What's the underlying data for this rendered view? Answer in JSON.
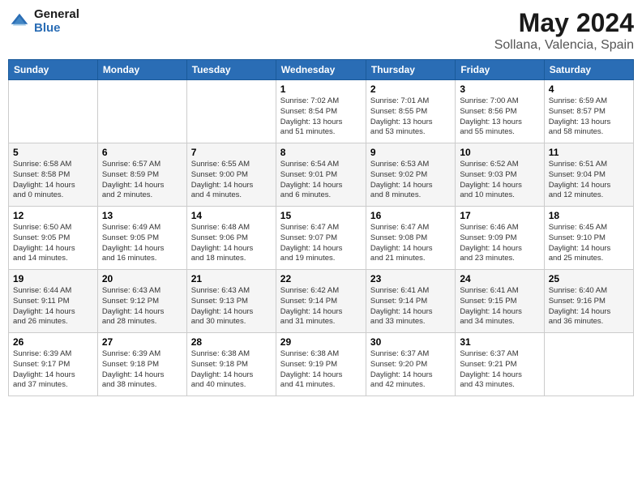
{
  "logo": {
    "line1": "General",
    "line2": "Blue"
  },
  "title": "May 2024",
  "subtitle": "Sollana, Valencia, Spain",
  "header_days": [
    "Sunday",
    "Monday",
    "Tuesday",
    "Wednesday",
    "Thursday",
    "Friday",
    "Saturday"
  ],
  "weeks": [
    [
      {
        "day": "",
        "info": ""
      },
      {
        "day": "",
        "info": ""
      },
      {
        "day": "",
        "info": ""
      },
      {
        "day": "1",
        "info": "Sunrise: 7:02 AM\nSunset: 8:54 PM\nDaylight: 13 hours\nand 51 minutes."
      },
      {
        "day": "2",
        "info": "Sunrise: 7:01 AM\nSunset: 8:55 PM\nDaylight: 13 hours\nand 53 minutes."
      },
      {
        "day": "3",
        "info": "Sunrise: 7:00 AM\nSunset: 8:56 PM\nDaylight: 13 hours\nand 55 minutes."
      },
      {
        "day": "4",
        "info": "Sunrise: 6:59 AM\nSunset: 8:57 PM\nDaylight: 13 hours\nand 58 minutes."
      }
    ],
    [
      {
        "day": "5",
        "info": "Sunrise: 6:58 AM\nSunset: 8:58 PM\nDaylight: 14 hours\nand 0 minutes."
      },
      {
        "day": "6",
        "info": "Sunrise: 6:57 AM\nSunset: 8:59 PM\nDaylight: 14 hours\nand 2 minutes."
      },
      {
        "day": "7",
        "info": "Sunrise: 6:55 AM\nSunset: 9:00 PM\nDaylight: 14 hours\nand 4 minutes."
      },
      {
        "day": "8",
        "info": "Sunrise: 6:54 AM\nSunset: 9:01 PM\nDaylight: 14 hours\nand 6 minutes."
      },
      {
        "day": "9",
        "info": "Sunrise: 6:53 AM\nSunset: 9:02 PM\nDaylight: 14 hours\nand 8 minutes."
      },
      {
        "day": "10",
        "info": "Sunrise: 6:52 AM\nSunset: 9:03 PM\nDaylight: 14 hours\nand 10 minutes."
      },
      {
        "day": "11",
        "info": "Sunrise: 6:51 AM\nSunset: 9:04 PM\nDaylight: 14 hours\nand 12 minutes."
      }
    ],
    [
      {
        "day": "12",
        "info": "Sunrise: 6:50 AM\nSunset: 9:05 PM\nDaylight: 14 hours\nand 14 minutes."
      },
      {
        "day": "13",
        "info": "Sunrise: 6:49 AM\nSunset: 9:05 PM\nDaylight: 14 hours\nand 16 minutes."
      },
      {
        "day": "14",
        "info": "Sunrise: 6:48 AM\nSunset: 9:06 PM\nDaylight: 14 hours\nand 18 minutes."
      },
      {
        "day": "15",
        "info": "Sunrise: 6:47 AM\nSunset: 9:07 PM\nDaylight: 14 hours\nand 19 minutes."
      },
      {
        "day": "16",
        "info": "Sunrise: 6:47 AM\nSunset: 9:08 PM\nDaylight: 14 hours\nand 21 minutes."
      },
      {
        "day": "17",
        "info": "Sunrise: 6:46 AM\nSunset: 9:09 PM\nDaylight: 14 hours\nand 23 minutes."
      },
      {
        "day": "18",
        "info": "Sunrise: 6:45 AM\nSunset: 9:10 PM\nDaylight: 14 hours\nand 25 minutes."
      }
    ],
    [
      {
        "day": "19",
        "info": "Sunrise: 6:44 AM\nSunset: 9:11 PM\nDaylight: 14 hours\nand 26 minutes."
      },
      {
        "day": "20",
        "info": "Sunrise: 6:43 AM\nSunset: 9:12 PM\nDaylight: 14 hours\nand 28 minutes."
      },
      {
        "day": "21",
        "info": "Sunrise: 6:43 AM\nSunset: 9:13 PM\nDaylight: 14 hours\nand 30 minutes."
      },
      {
        "day": "22",
        "info": "Sunrise: 6:42 AM\nSunset: 9:14 PM\nDaylight: 14 hours\nand 31 minutes."
      },
      {
        "day": "23",
        "info": "Sunrise: 6:41 AM\nSunset: 9:14 PM\nDaylight: 14 hours\nand 33 minutes."
      },
      {
        "day": "24",
        "info": "Sunrise: 6:41 AM\nSunset: 9:15 PM\nDaylight: 14 hours\nand 34 minutes."
      },
      {
        "day": "25",
        "info": "Sunrise: 6:40 AM\nSunset: 9:16 PM\nDaylight: 14 hours\nand 36 minutes."
      }
    ],
    [
      {
        "day": "26",
        "info": "Sunrise: 6:39 AM\nSunset: 9:17 PM\nDaylight: 14 hours\nand 37 minutes."
      },
      {
        "day": "27",
        "info": "Sunrise: 6:39 AM\nSunset: 9:18 PM\nDaylight: 14 hours\nand 38 minutes."
      },
      {
        "day": "28",
        "info": "Sunrise: 6:38 AM\nSunset: 9:18 PM\nDaylight: 14 hours\nand 40 minutes."
      },
      {
        "day": "29",
        "info": "Sunrise: 6:38 AM\nSunset: 9:19 PM\nDaylight: 14 hours\nand 41 minutes."
      },
      {
        "day": "30",
        "info": "Sunrise: 6:37 AM\nSunset: 9:20 PM\nDaylight: 14 hours\nand 42 minutes."
      },
      {
        "day": "31",
        "info": "Sunrise: 6:37 AM\nSunset: 9:21 PM\nDaylight: 14 hours\nand 43 minutes."
      },
      {
        "day": "",
        "info": ""
      }
    ]
  ]
}
